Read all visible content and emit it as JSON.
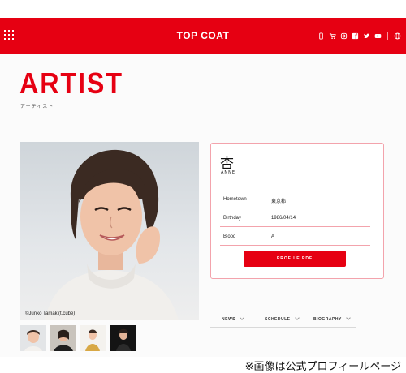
{
  "header": {
    "brand": "TOP COAT",
    "icons": [
      "phone-icon",
      "cart-icon",
      "instagram-icon",
      "facebook-icon",
      "twitter-icon",
      "youtube-icon",
      "globe-icon"
    ],
    "accent": "#e60012"
  },
  "page": {
    "title": "ARTIST",
    "subtitle": "アーティスト"
  },
  "photo": {
    "credit": "©Junko Tamaki(t.cube)"
  },
  "profile": {
    "name": "杏",
    "reading": "ANNE",
    "rows": [
      {
        "label": "Hometown",
        "value": "東京都"
      },
      {
        "label": "Birthday",
        "value": "1986/04/14"
      },
      {
        "label": "Blood",
        "value": "A"
      }
    ],
    "pdf_button": "PROFILE PDF"
  },
  "tabs": [
    "NEWS",
    "SCHEDULE",
    "BIOGRAPHY"
  ],
  "caption": "※画像は公式プロフィールページ"
}
